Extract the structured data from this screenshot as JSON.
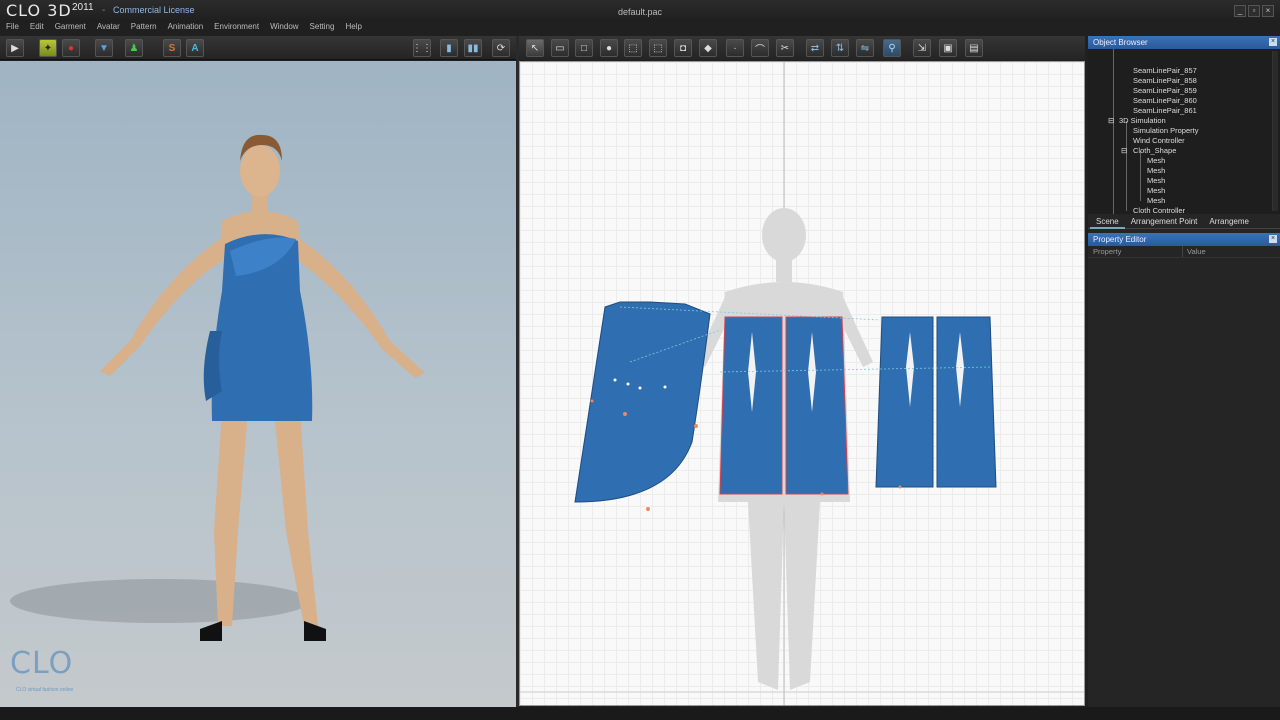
{
  "app": {
    "logo": "CLO",
    "logo_suffix": "3D",
    "year": "2011",
    "separator": "-",
    "license": "Commercial License",
    "doc_title": "default.pac"
  },
  "window_buttons": [
    "_",
    "▫",
    "×"
  ],
  "menu": [
    "File",
    "Edit",
    "Garment",
    "Avatar",
    "Pattern",
    "Animation",
    "Environment",
    "Window",
    "Setting",
    "Help"
  ],
  "view3d": {
    "watermark": "CLO",
    "watermark_sub": "CLO virtual fashion online"
  },
  "object_browser": {
    "title": "Object Browser",
    "items": [
      {
        "label": "SeamLinePair_857",
        "level": 3
      },
      {
        "label": "SeamLinePair_858",
        "level": 3
      },
      {
        "label": "SeamLinePair_859",
        "level": 3
      },
      {
        "label": "SeamLinePair_860",
        "level": 3
      },
      {
        "label": "SeamLinePair_861",
        "level": 3
      },
      {
        "label": "3D Simulation",
        "level": 1
      },
      {
        "label": "Simulation Property",
        "level": 2
      },
      {
        "label": "Wind Controller",
        "level": 2
      },
      {
        "label": "Cloth_Shape",
        "level": 2
      },
      {
        "label": "Mesh",
        "level": 3
      },
      {
        "label": "Mesh",
        "level": 3
      },
      {
        "label": "Mesh",
        "level": 3
      },
      {
        "label": "Mesh",
        "level": 3
      },
      {
        "label": "Mesh",
        "level": 3
      },
      {
        "label": "Cloth Controller",
        "level": 2
      }
    ],
    "tabs": [
      "Scene",
      "Arrangement Point",
      "Arrangeme"
    ],
    "active_tab": "Scene"
  },
  "property_editor": {
    "title": "Property Editor",
    "col_property": "Property",
    "col_value": "Value"
  },
  "colors": {
    "garment_blue": "#2f6eb0",
    "panel_header": "#3a73b8"
  }
}
